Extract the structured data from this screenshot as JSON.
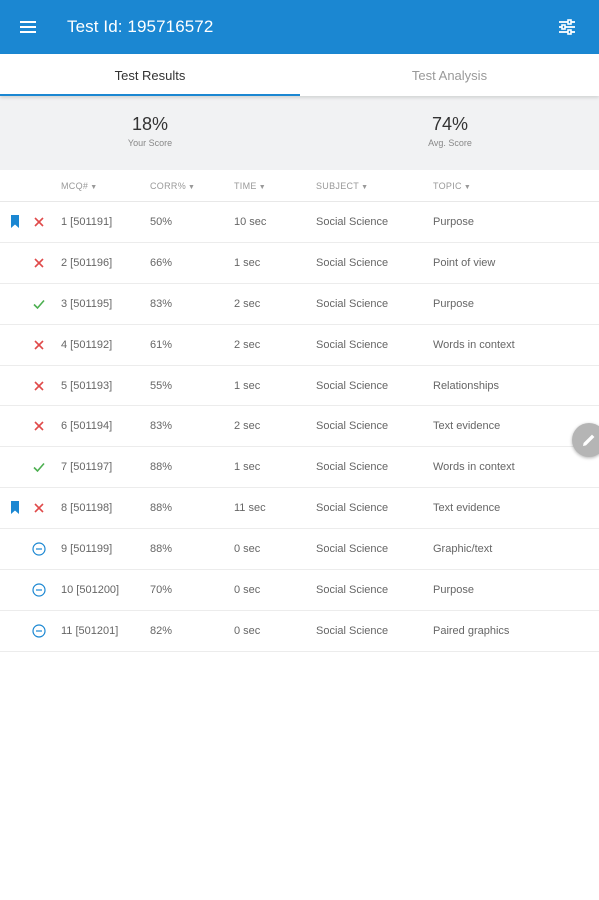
{
  "appbar": {
    "title": "Test Id: 195716572",
    "menu_icon": "hamburger-menu-icon",
    "filter_icon": "sliders-icon"
  },
  "tabs": [
    {
      "label": "Test Results",
      "active": true
    },
    {
      "label": "Test Analysis",
      "active": false
    }
  ],
  "scores": {
    "your_score": {
      "value": "18%",
      "label": "Your Score"
    },
    "avg_score": {
      "value": "74%",
      "label": "Avg. Score"
    }
  },
  "columns": {
    "mcq": "MCQ#",
    "corr": "CORR%",
    "time": "TIME",
    "subject": "SUBJECT",
    "topic": "TOPIC"
  },
  "colors": {
    "primary": "#1b87d2",
    "incorrect": "#e04a4a",
    "correct": "#4caf50",
    "skipped": "#1b87d2"
  },
  "rows": [
    {
      "bookmarked": true,
      "status": "incorrect",
      "mcq": "1 [501191]",
      "corr": "50%",
      "time": "10 sec",
      "subject": "Social Science",
      "topic": "Purpose"
    },
    {
      "bookmarked": false,
      "status": "incorrect",
      "mcq": "2 [501196]",
      "corr": "66%",
      "time": "1 sec",
      "subject": "Social Science",
      "topic": "Point of view"
    },
    {
      "bookmarked": false,
      "status": "correct",
      "mcq": "3 [501195]",
      "corr": "83%",
      "time": "2 sec",
      "subject": "Social Science",
      "topic": "Purpose"
    },
    {
      "bookmarked": false,
      "status": "incorrect",
      "mcq": "4 [501192]",
      "corr": "61%",
      "time": "2 sec",
      "subject": "Social Science",
      "topic": "Words in context"
    },
    {
      "bookmarked": false,
      "status": "incorrect",
      "mcq": "5 [501193]",
      "corr": "55%",
      "time": "1 sec",
      "subject": "Social Science",
      "topic": "Relationships"
    },
    {
      "bookmarked": false,
      "status": "incorrect",
      "mcq": "6 [501194]",
      "corr": "83%",
      "time": "2 sec",
      "subject": "Social Science",
      "topic": "Text evidence"
    },
    {
      "bookmarked": false,
      "status": "correct",
      "mcq": "7 [501197]",
      "corr": "88%",
      "time": "1 sec",
      "subject": "Social Science",
      "topic": "Words in context"
    },
    {
      "bookmarked": true,
      "status": "incorrect",
      "mcq": "8 [501198]",
      "corr": "88%",
      "time": "11 sec",
      "subject": "Social Science",
      "topic": "Text evidence"
    },
    {
      "bookmarked": false,
      "status": "skipped",
      "mcq": "9 [501199]",
      "corr": "88%",
      "time": "0 sec",
      "subject": "Social Science",
      "topic": "Graphic/text"
    },
    {
      "bookmarked": false,
      "status": "skipped",
      "mcq": "10 [501200]",
      "corr": "70%",
      "time": "0 sec",
      "subject": "Social Science",
      "topic": "Purpose"
    },
    {
      "bookmarked": false,
      "status": "skipped",
      "mcq": "11 [501201]",
      "corr": "82%",
      "time": "0 sec",
      "subject": "Social Science",
      "topic": "Paired graphics"
    }
  ],
  "fab": {
    "icon": "pencil-icon"
  }
}
